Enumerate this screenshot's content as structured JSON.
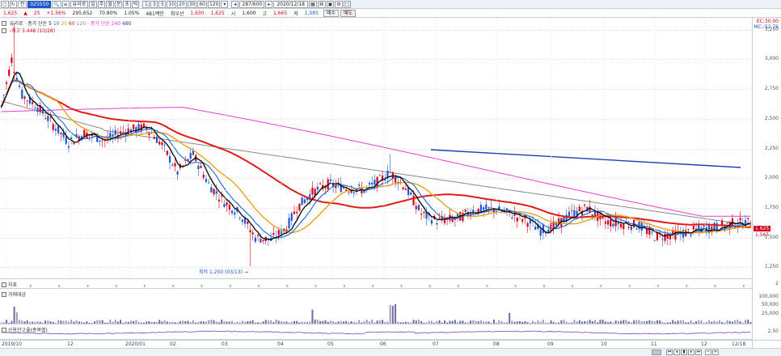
{
  "toolbar": {
    "period": "전",
    "symbol": "025550",
    "search_label": "유리로",
    "tf_buttons": [
      "일",
      "주",
      "월",
      "분",
      "초",
      "틱"
    ],
    "num_buttons": [
      "1",
      "3",
      "5",
      "10",
      "20",
      "30",
      "60",
      "120"
    ],
    "count": "287/600",
    "date": "2020/12/18"
  },
  "quote": {
    "price": "1,625",
    "change": "25",
    "change_pct": "+1.56%",
    "volume": "295,652",
    "vol_ratio": "70.80%",
    "turnover": "1.05%",
    "amount": "481백만",
    "prev_label": "최우선",
    "bid": "1,630",
    "ask": "1,625",
    "high_label": "시",
    "open": "1,600",
    "high_lbl2": "고",
    "high": "1,665",
    "low_lbl": "저",
    "low": "1,585",
    "buy": "매수",
    "sell": "매도"
  },
  "price_panel": {
    "legend1_title": "유리로",
    "legend1_ma": "종가 단순",
    "legend1_periods": [
      "5",
      "10",
      "20",
      "60",
      "120"
    ],
    "legend1_ma2": "종가 단순 240",
    "legend1_ma3": "480",
    "legend2": "-최고 3.448 (10/28)",
    "low_note": "최저 1.250 (03/13)",
    "right_top1": "EC:30.00",
    "right_top2": "MC:-52.76",
    "last_price": "1.625",
    "last_price2": "1.565",
    "y_ticks": [
      "3,250",
      "3,000",
      "2,750",
      "2,500",
      "2,250",
      "2,000",
      "1,750",
      "1,500",
      "1,250"
    ]
  },
  "mini_panel": {
    "label": "지표",
    "tick": "2"
  },
  "volume_panel": {
    "label": "거래대금",
    "ticks": [
      "100,000",
      "50,000",
      "25,000"
    ]
  },
  "credit_panel": {
    "label": "신용잔고율(종목별)",
    "tick": "2.50"
  },
  "x_labels": [
    "2019/10",
    "12",
    "2020/01",
    "02",
    "03",
    "04",
    "05",
    "06",
    "07",
    "08",
    "09",
    "10",
    "11",
    "12",
    "12/18"
  ],
  "colors": {
    "up": "#d0021b",
    "down": "#1e56d0",
    "ma5": "#111111",
    "ma10": "#2b6fd6",
    "ma20": "#e8a21a",
    "ma60": "#e01b1b",
    "ma120": "#888888",
    "ma240": "#e040d0",
    "trend": "#1f3fb0"
  }
}
